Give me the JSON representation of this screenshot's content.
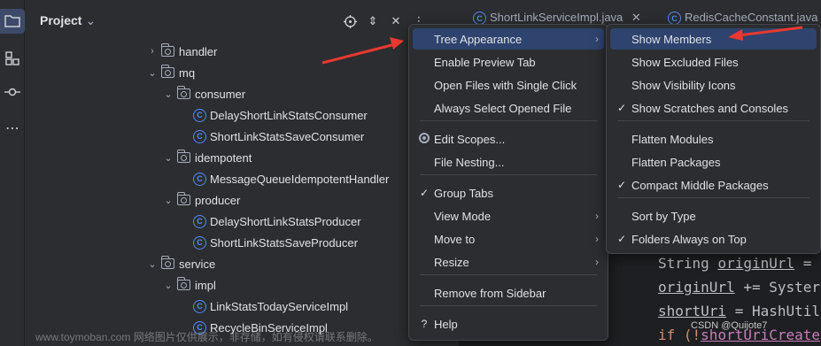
{
  "panel": {
    "title": "Project",
    "title_chevron": "⌄"
  },
  "tree": [
    {
      "label": "handler",
      "kind": "folder",
      "expanded": false
    },
    {
      "label": "mq",
      "kind": "folder",
      "expanded": true
    },
    {
      "label": "consumer",
      "kind": "folder",
      "expanded": true
    },
    {
      "label": "DelayShortLinkStatsConsumer",
      "kind": "class"
    },
    {
      "label": "ShortLinkStatsSaveConsumer",
      "kind": "class"
    },
    {
      "label": "idempotent",
      "kind": "folder",
      "expanded": true
    },
    {
      "label": "MessageQueueIdempotentHandler",
      "kind": "class"
    },
    {
      "label": "producer",
      "kind": "folder",
      "expanded": true
    },
    {
      "label": "DelayShortLinkStatsProducer",
      "kind": "class"
    },
    {
      "label": "ShortLinkStatsSaveProducer",
      "kind": "class"
    },
    {
      "label": "service",
      "kind": "folder",
      "expanded": true
    },
    {
      "label": "impl",
      "kind": "folder",
      "expanded": true
    },
    {
      "label": "LinkStatsTodayServiceImpl",
      "kind": "class"
    },
    {
      "label": "RecycleBinServiceImpl",
      "kind": "class"
    }
  ],
  "editor": {
    "tabs": [
      "ShortLinkServiceImpl.java",
      "RedisCacheConstant.java"
    ],
    "code": [
      {
        "parts": [
          "String ",
          "originUrl",
          " ="
        ]
      },
      {
        "parts": [
          "originUrl",
          " += Syster"
        ]
      },
      {
        "parts": [
          "shortUri",
          " = HashUtil"
        ]
      },
      {
        "parts": [
          "if (!",
          "shortUriCreate"
        ]
      }
    ]
  },
  "main_menu": [
    {
      "label": "Tree Appearance",
      "submenu": true,
      "selected": true
    },
    {
      "label": "Enable Preview Tab"
    },
    {
      "label": "Open Files with Single Click"
    },
    {
      "label": "Always Select Opened File"
    },
    {
      "label": "Edit Scopes...",
      "lead": "radio"
    },
    {
      "label": "File Nesting..."
    },
    {
      "label": "Group Tabs",
      "lead": "check"
    },
    {
      "label": "View Mode",
      "submenu": true
    },
    {
      "label": "Move to",
      "submenu": true
    },
    {
      "label": "Resize",
      "submenu": true
    },
    {
      "label": "Remove from Sidebar"
    },
    {
      "label": "Help",
      "lead": "question"
    }
  ],
  "sub_menu": [
    {
      "label": "Show Members",
      "selected": true
    },
    {
      "label": "Show Excluded Files"
    },
    {
      "label": "Show Visibility Icons"
    },
    {
      "label": "Show Scratches and Consoles",
      "checked": true
    },
    {
      "label": "Flatten Modules"
    },
    {
      "label": "Flatten Packages"
    },
    {
      "label": "Compact Middle Packages",
      "checked": true
    },
    {
      "label": "Sort by Type"
    },
    {
      "label": "Folders Always on Top",
      "checked": true
    }
  ],
  "icons": {
    "submenu_arrow": "›",
    "check": "✓",
    "question": "?",
    "locate": "⊕",
    "expand_collapse": "⇕",
    "close": "✕",
    "more": "⋮",
    "tree_collapsed": "›",
    "tree_expanded": "⌄",
    "class_letter": "C"
  },
  "watermark": "CSDN @Quijote7",
  "watermark_bottom": "www.toymoban.com 网络图片仅供展示，非存储，如有侵权请联系删除。",
  "colors": {
    "selection": "#2e436e",
    "accent": "#548af7",
    "arrow": "#e8382f"
  }
}
